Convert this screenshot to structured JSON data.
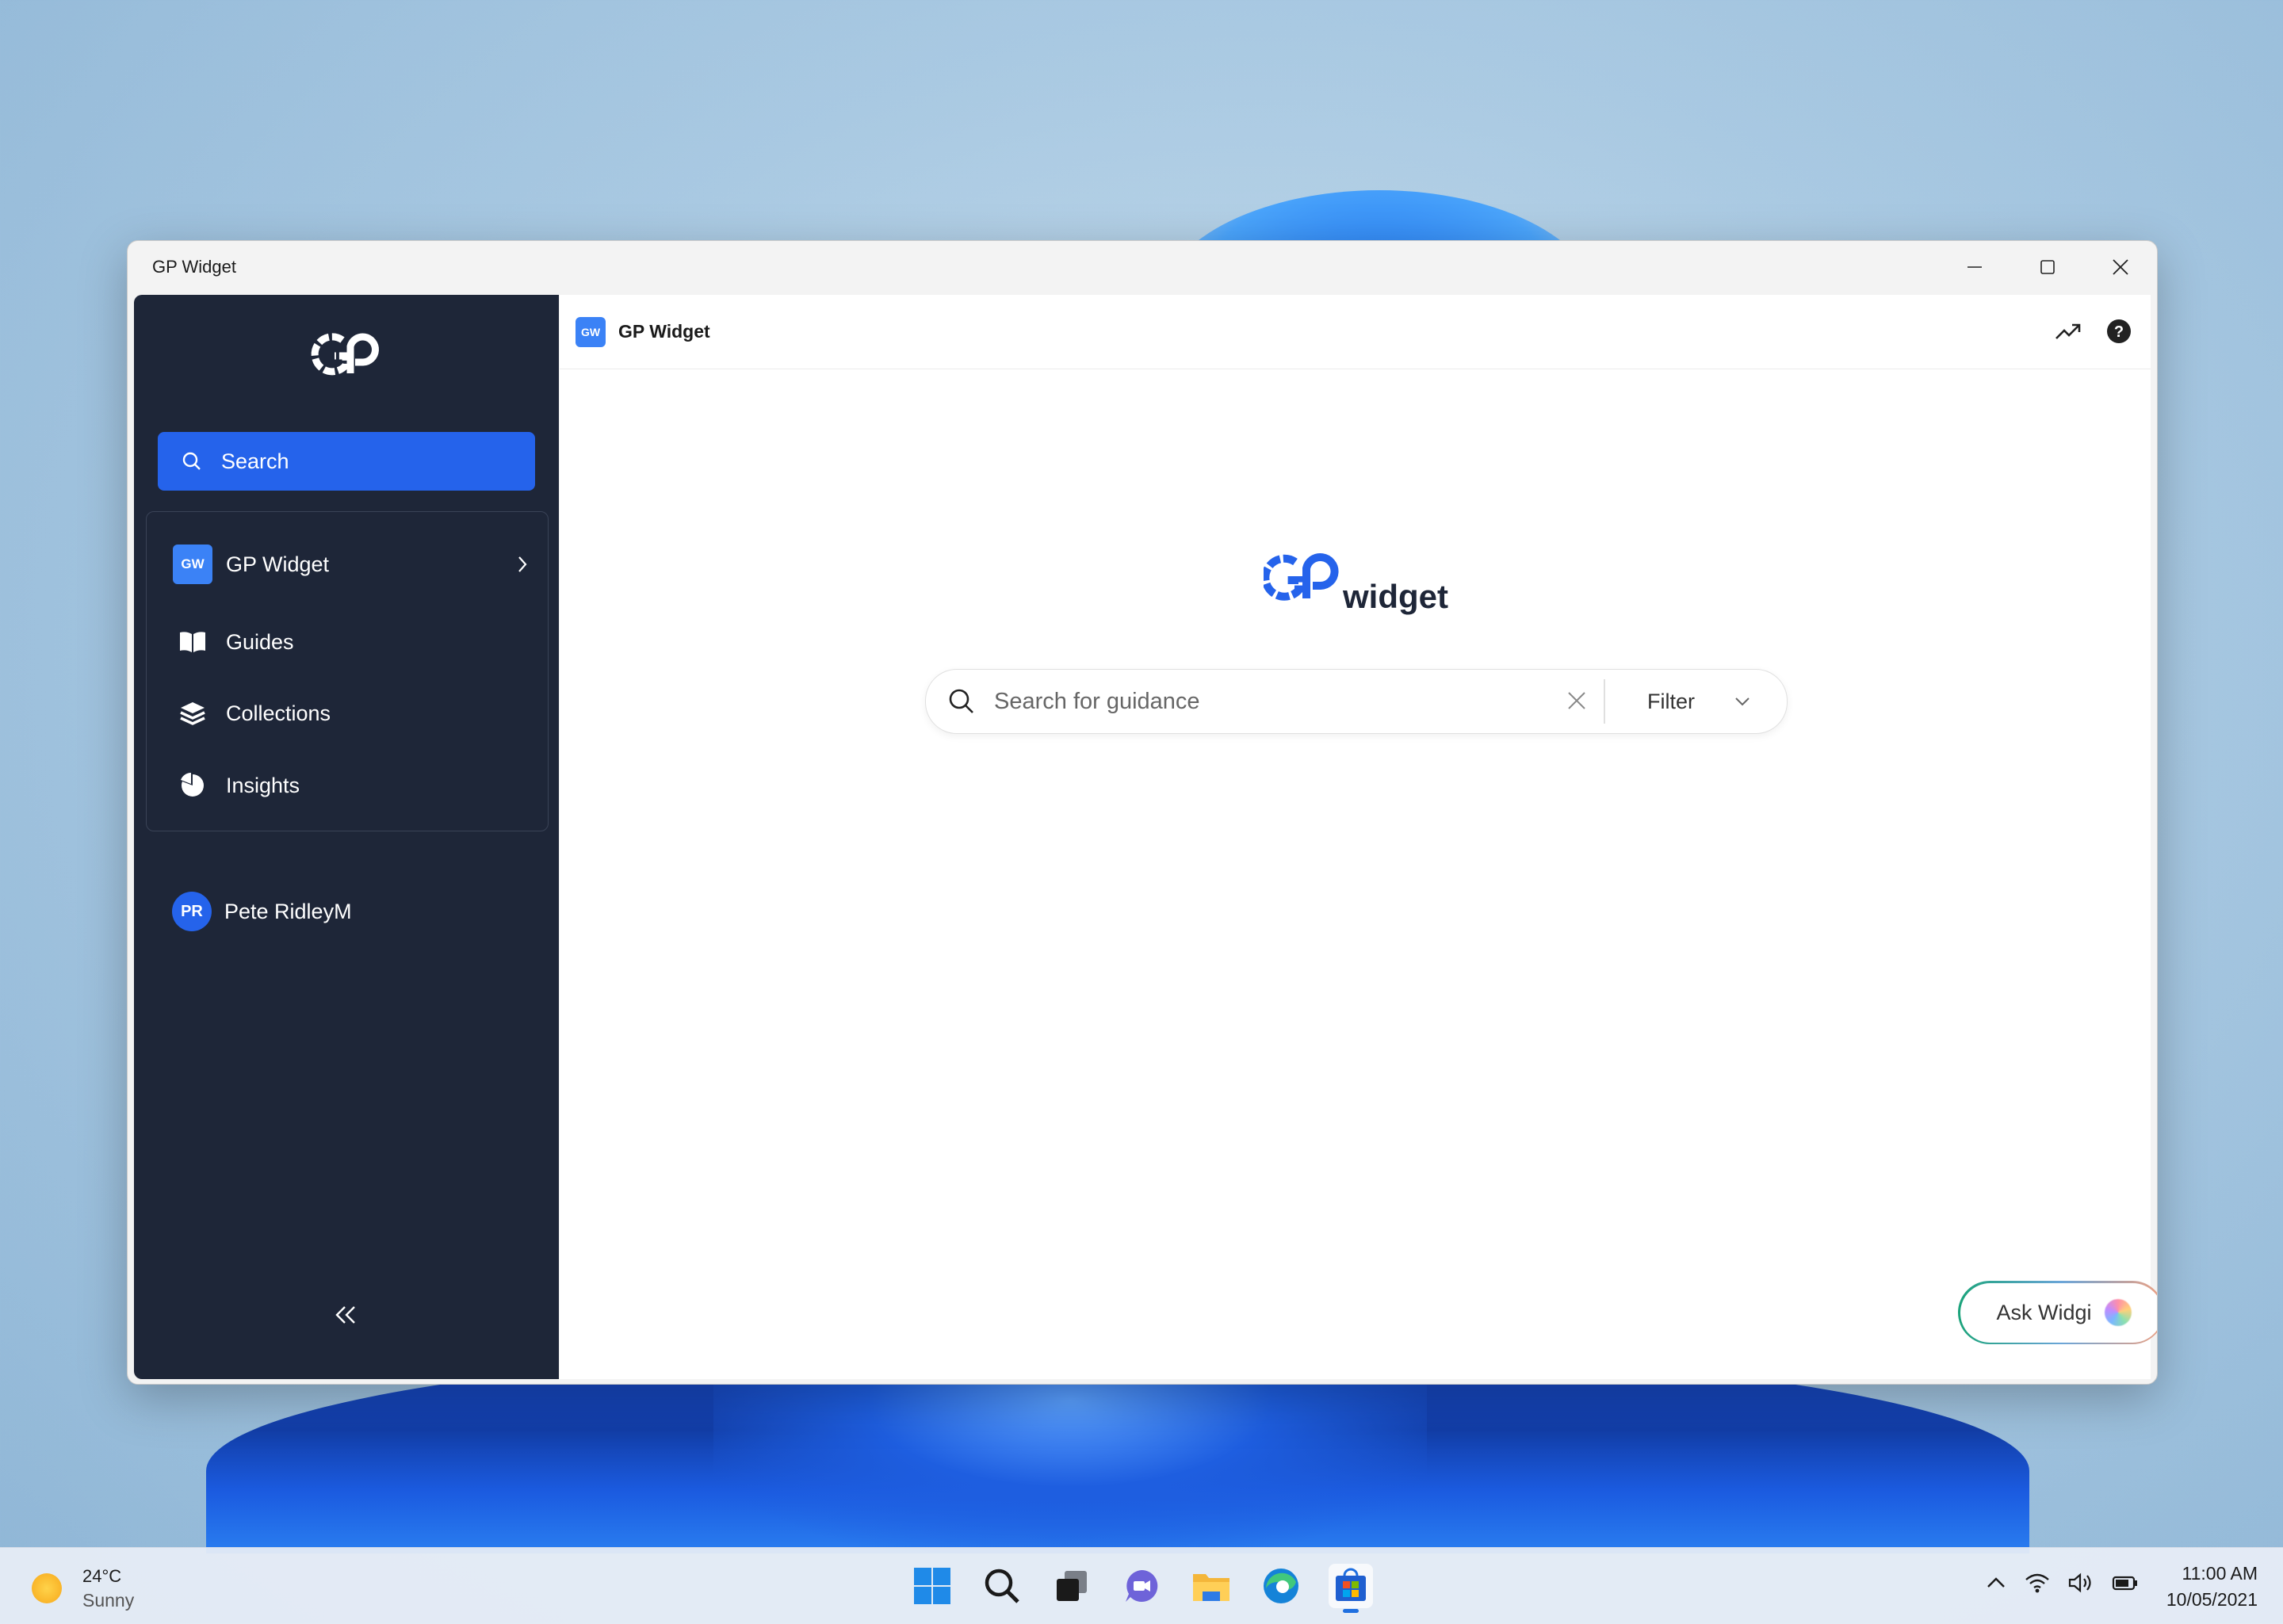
{
  "window": {
    "title": "GP Widget"
  },
  "sidebar": {
    "search_label": "Search",
    "workspace": {
      "badge": "GW",
      "label": "GP Widget"
    },
    "items": [
      {
        "label": "Guides",
        "icon": "book-icon"
      },
      {
        "label": "Collections",
        "icon": "layers-icon"
      },
      {
        "label": "Insights",
        "icon": "pie-chart-icon"
      }
    ],
    "user": {
      "initials": "PR",
      "name": "Pete RidleyM"
    }
  },
  "main": {
    "header": {
      "badge": "GW",
      "title": "GP Widget"
    },
    "logo_text": "widget",
    "search": {
      "placeholder": "Search for guidance",
      "value": ""
    },
    "filter_label": "Filter",
    "ask_label": "Ask Widgi"
  },
  "taskbar": {
    "weather": {
      "temp": "24°C",
      "condition": "Sunny"
    },
    "clock": {
      "time": "11:00 AM",
      "date": "10/05/2021"
    }
  },
  "colors": {
    "accent": "#2563eb",
    "sidebar_bg": "#1e2638",
    "badge": "#3b82f6"
  }
}
